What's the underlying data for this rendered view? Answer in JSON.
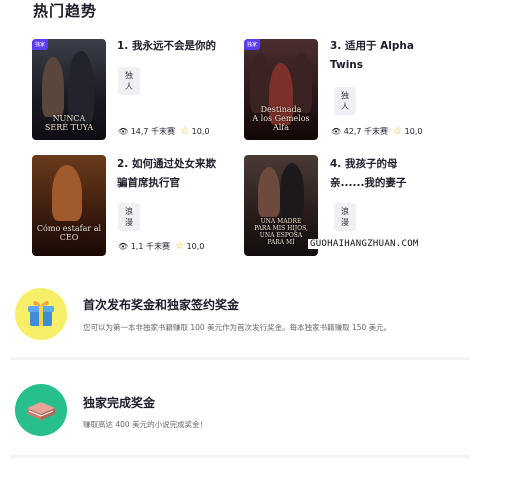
{
  "section_title": "热门趋势",
  "books": [
    {
      "title": "1. 我永远不会是你的",
      "tag": "独人",
      "reads": "14,7 千末赛",
      "rating": "10,0",
      "cover_text": "NUNCA\nSERÉ TUYA",
      "badge": "独家"
    },
    {
      "title": "3. 适用于 Alpha Twins",
      "tag": "独人",
      "reads": "42,7 千末赛",
      "rating": "10,0",
      "cover_text": "Destinada\nA los Gemelos Alfa",
      "badge": "独家"
    },
    {
      "title": "2. 如何通过处女来欺骗首席执行官",
      "tag": "浪漫",
      "reads": "1,1 千末赛",
      "rating": "10,0",
      "cover_text": "Cómo estafar al\nCEO"
    },
    {
      "title": "4. 我孩子的母亲......我的妻子",
      "tag": "浪漫",
      "reads": "",
      "rating": "",
      "cover_text": "UNA MADRE\nPARA MIS HIJOS,\nUNA ESPOSA\nPARA MÍ"
    }
  ],
  "watermark": "GUOHAIHANGZHUAN.COM",
  "bonuses": [
    {
      "title": "首次发布奖金和独家签约奖金",
      "desc": "您可以为第一本非独家书籍赚取 100 美元作为首次发行奖金。每本独家书籍赚取 150 美元。",
      "icon": "gift-icon",
      "color": "#f7ef67"
    },
    {
      "title": "独家完成奖金",
      "desc": "赚取高达 400 美元的小说完成奖金！",
      "icon": "book-icon",
      "color": "#27c08d"
    }
  ]
}
